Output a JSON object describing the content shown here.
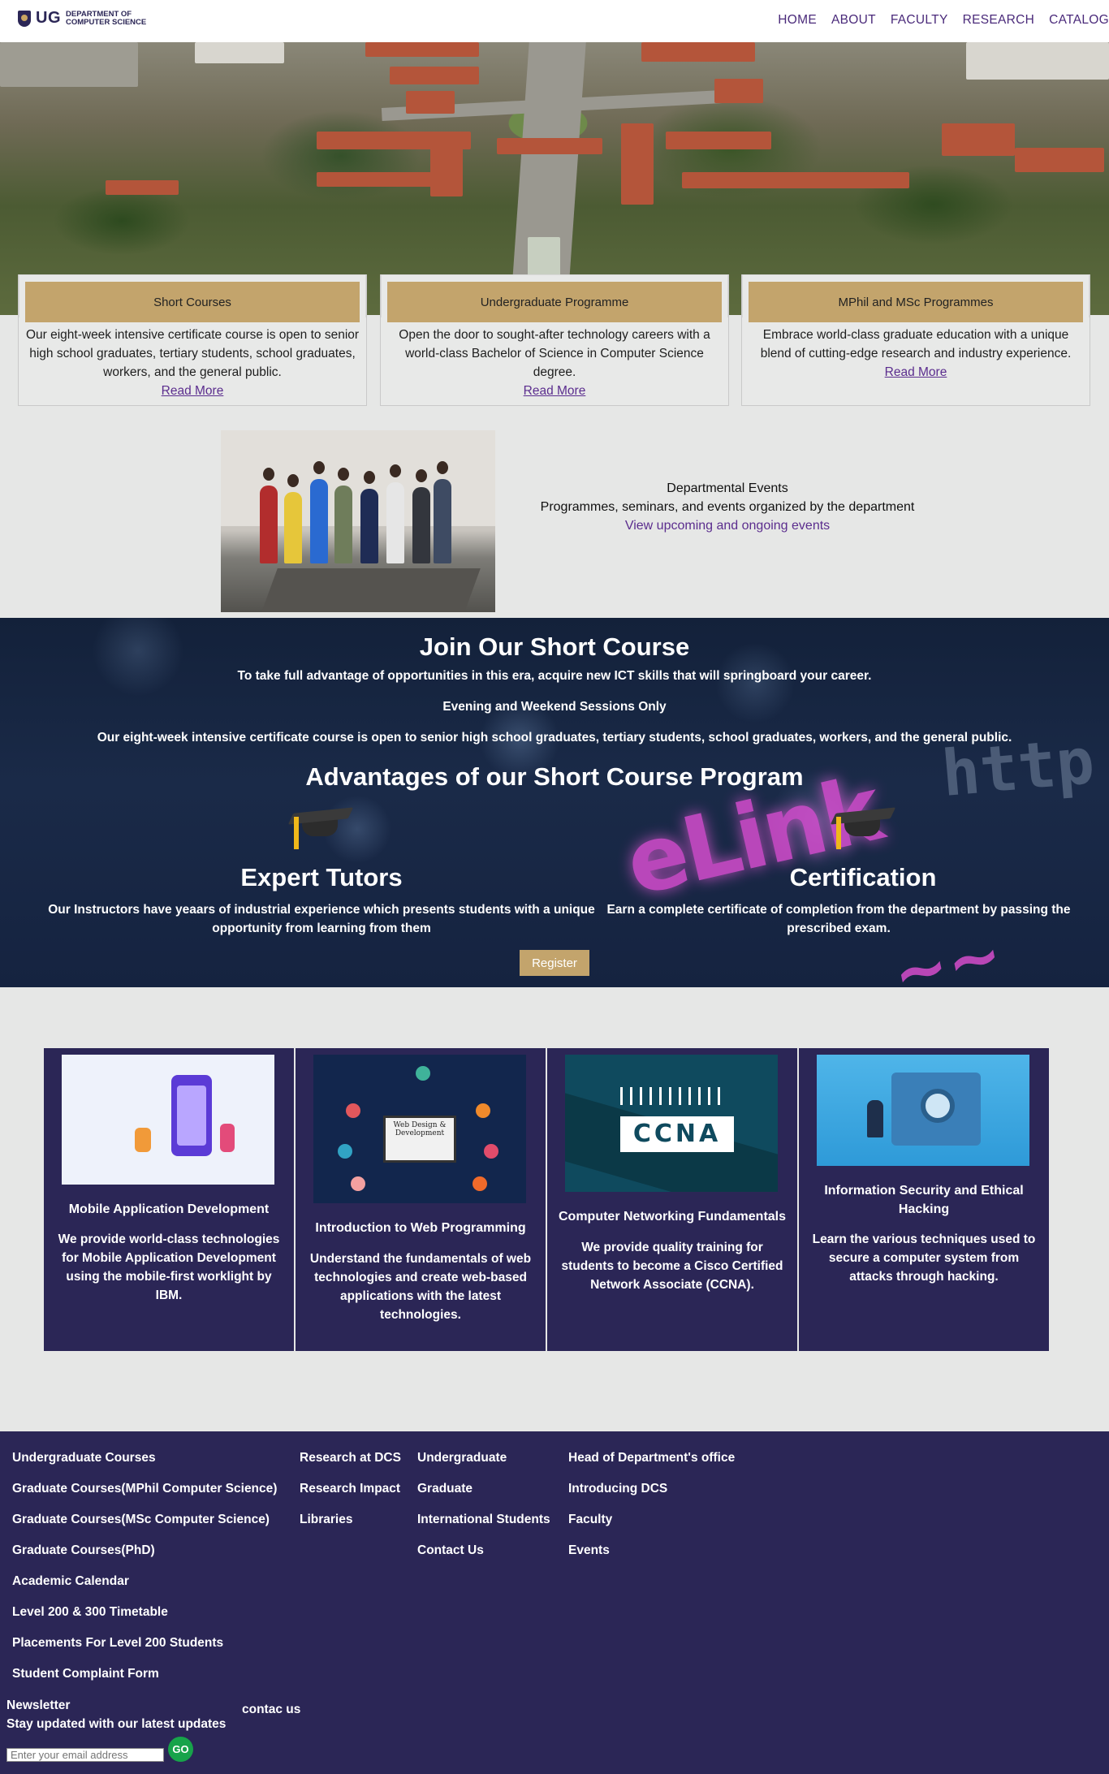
{
  "header": {
    "logo_mark": "UG",
    "logo_line1": "DEPARTMENT OF",
    "logo_line2": "COMPUTER SCIENCE",
    "nav": [
      "HOME",
      "ABOUT",
      "FACULTY",
      "RESEARCH",
      "CATALOG"
    ]
  },
  "programmes": [
    {
      "title": "Short Courses",
      "body": "Our eight-week intensive certificate course is open to senior high school graduates, tertiary students, school graduates, workers, and the general public.",
      "link": "Read More"
    },
    {
      "title": "Undergraduate Programme",
      "body": "Open the door to sought-after technology careers with a world-class Bachelor of Science in Computer Science degree.",
      "link": "Read More"
    },
    {
      "title": "MPhil and MSc Programmes",
      "body": "Embrace world-class graduate education with a unique blend of cutting-edge research and industry experience.",
      "link": "Read More"
    }
  ],
  "events": {
    "title": "Departmental Events",
    "subtitle": "Programmes, seminars, and events organized by the department",
    "link": "View upcoming and ongoing events"
  },
  "short_course": {
    "title": "Join Our Short Course",
    "intro": "To take full advantage of opportunities in this era, acquire new ICT skills that will springboard your career.",
    "sessions": "Evening and Weekend Sessions Only",
    "description": "Our eight-week intensive certificate course is open to senior high school graduates, tertiary students, school graduates, workers, and the general public.",
    "advantages_title": "Advantages of our Short Course Program",
    "advantages": [
      {
        "title": "Expert Tutors",
        "body": "Our Instructors have yeaars of industrial experience which presents students with a unique opportunity from learning from them",
        "icon": "graduation-cap-icon"
      },
      {
        "title": "Certification",
        "body": "Earn a complete certificate of completion from the department by passing the prescribed exam.",
        "icon": "graduation-cap-icon"
      }
    ],
    "register_label": "Register",
    "bg_text_1": "eLink",
    "bg_text_2": "http"
  },
  "courses": [
    {
      "title": "Mobile Application Development",
      "body": "We provide world-class technologies for Mobile Application Development using the mobile-first worklight by IBM."
    },
    {
      "title": "Introduction to Web Programming",
      "body": "Understand the fundamentals of web technologies and create web-based applications with the latest technologies.",
      "image_caption": "Web Design & Development"
    },
    {
      "title": "Computer Networking Fundamentals",
      "body": "We provide quality training for students to become a Cisco Certified Network Associate (CCNA).",
      "image_caption": "CCNA"
    },
    {
      "title": "Information Security and Ethical Hacking",
      "body": "Learn the various techniques used to secure a computer system from attacks through hacking."
    }
  ],
  "footer": {
    "col1": [
      "Undergraduate Courses",
      "Graduate Courses(MPhil Computer Science)",
      "Graduate Courses(MSc Computer Science)",
      "Graduate Courses(PhD)",
      "Academic Calendar",
      "Level 200 & 300 Timetable",
      "Placements For Level 200 Students",
      "Student Complaint Form"
    ],
    "col2": [
      "Research at DCS",
      "Research Impact",
      "Libraries"
    ],
    "col3": [
      "Undergraduate",
      "Graduate",
      "International Students",
      "Contact Us"
    ],
    "col4": [
      "Head of Department's office",
      "Introducing DCS",
      "Faculty",
      "Events"
    ],
    "newsletter_title": "Newsletter",
    "newsletter_sub": "Stay updated with our latest updates",
    "contact_label": "contac us",
    "email_placeholder": "Enter your email address",
    "go_label": "GO"
  },
  "colors": {
    "brand_purple": "#2b2656",
    "accent_gold": "#c3a46c",
    "link_purple": "#5b2d8e",
    "go_green": "#17a34a"
  }
}
